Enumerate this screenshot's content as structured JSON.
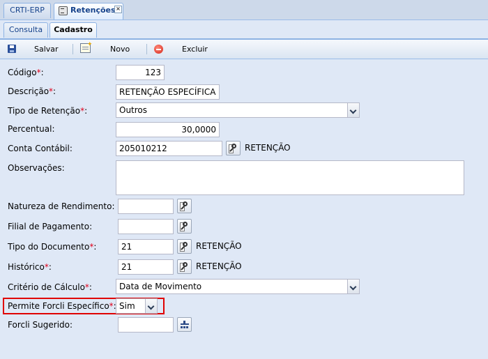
{
  "app_tabs": [
    {
      "label": "CRTI-ERP"
    },
    {
      "label": "Retenções"
    }
  ],
  "sub_tabs": [
    {
      "label": "Consulta"
    },
    {
      "label": "Cadastro"
    }
  ],
  "toolbar": {
    "save_label": "Salvar",
    "new_label": "Novo",
    "delete_label": "Excluir"
  },
  "form": {
    "codigo": {
      "label": "Código",
      "value": "123"
    },
    "descricao": {
      "label": "Descrição",
      "value": "RETENÇÃO ESPECÍFICA"
    },
    "tipo_retencao": {
      "label": "Tipo de Retenção",
      "value": "Outros"
    },
    "percentual": {
      "label": "Percentual:",
      "value": "30,0000"
    },
    "conta_contabil": {
      "label": "Conta Contábil:",
      "value": "205010212",
      "description": "RETENÇÃO"
    },
    "observacoes": {
      "label": "Observações:",
      "value": ""
    },
    "natureza_rendimento": {
      "label": "Natureza de Rendimento:",
      "value": ""
    },
    "filial_pagamento": {
      "label": "Filial de Pagamento:",
      "value": ""
    },
    "tipo_documento": {
      "label": "Tipo do Documento",
      "value": "21",
      "description": "RETENÇÃO"
    },
    "historico": {
      "label": "Histórico",
      "value": "21",
      "description": "RETENÇÃO"
    },
    "criterio_calculo": {
      "label": "Critério de Cálculo",
      "value": "Data de Movimento"
    },
    "permite_forcli": {
      "label": "Permite Forcli Específico",
      "value": "Sim"
    },
    "forcli_sugerido": {
      "label": "Forcli Sugerido:",
      "value": ""
    }
  },
  "required_mark": "*",
  "colon": ":",
  "colors": {
    "required": "#e0001a",
    "highlight": "#e00000",
    "panel_bg": "#dfe8f6"
  }
}
